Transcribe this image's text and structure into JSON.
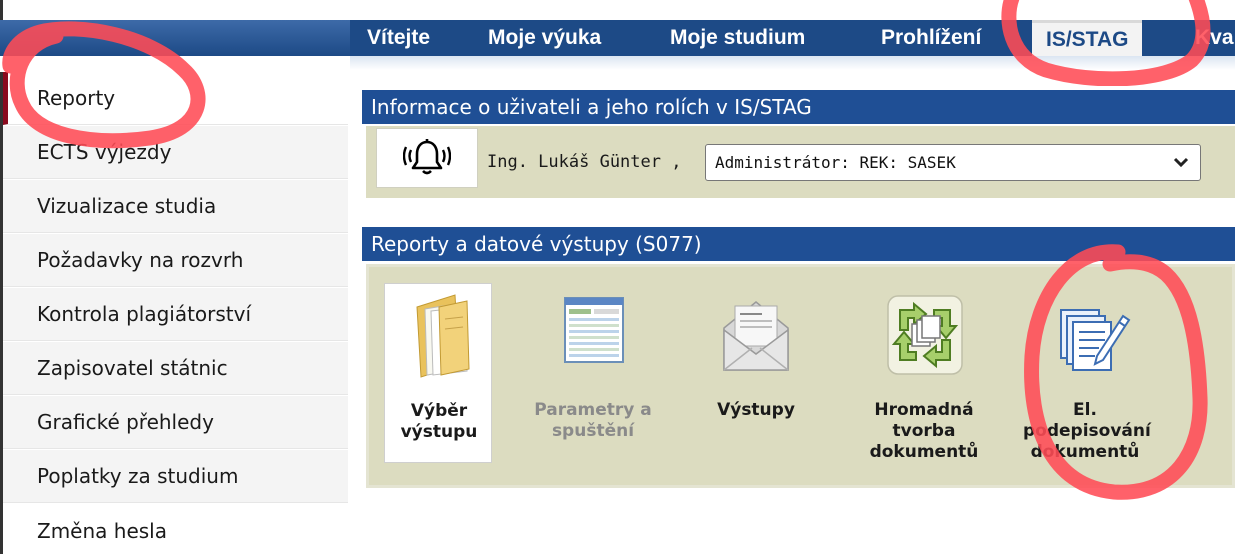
{
  "nav": {
    "tabs": [
      {
        "label": "Vítejte"
      },
      {
        "label": "Moje výuka"
      },
      {
        "label": "Moje studium"
      },
      {
        "label": "Prohlížení"
      },
      {
        "label": "IS/STAG",
        "active": true
      },
      {
        "label": "Kva"
      }
    ]
  },
  "sidebar": {
    "items": [
      {
        "label": "Reporty",
        "active": true
      },
      {
        "label": "ECTS výjezdy"
      },
      {
        "label": "Vizualizace studia"
      },
      {
        "label": "Požadavky na rozvrh"
      },
      {
        "label": "Kontrola plagiátorství"
      },
      {
        "label": "Zapisovatel státnic"
      },
      {
        "label": "Grafické přehledy"
      },
      {
        "label": "Poplatky za studium"
      },
      {
        "label": "Změna hesla"
      }
    ]
  },
  "user_panel": {
    "title": "Informace o uživateli a jeho rolích v IS/STAG",
    "user_name": "Ing. Lukáš Günter ,",
    "role_selected": "Administrátor: REK: SASEK"
  },
  "reports_panel": {
    "title": "Reporty a datové výstupy (S077)",
    "tiles": [
      {
        "label": "Výběr\nvýstupu",
        "icon": "folder-icon",
        "selected": true
      },
      {
        "label": "Parametry a\nspuštění",
        "icon": "spreadsheet-icon",
        "disabled": true
      },
      {
        "label": "Výstupy",
        "icon": "envelope-icon"
      },
      {
        "label": "Hromadná\ntvorba\ndokumentů",
        "icon": "batch-documents-icon"
      },
      {
        "label": "El.\npodepisování\ndokumentů",
        "icon": "document-sign-icon"
      }
    ]
  },
  "colors": {
    "nav_bg": "#1d4a86",
    "panel_header": "#1f4f95",
    "panel_body": "#dcdcc0",
    "sidebar_active_marker": "#8a0a1e",
    "annotation": "#ff4b55"
  }
}
